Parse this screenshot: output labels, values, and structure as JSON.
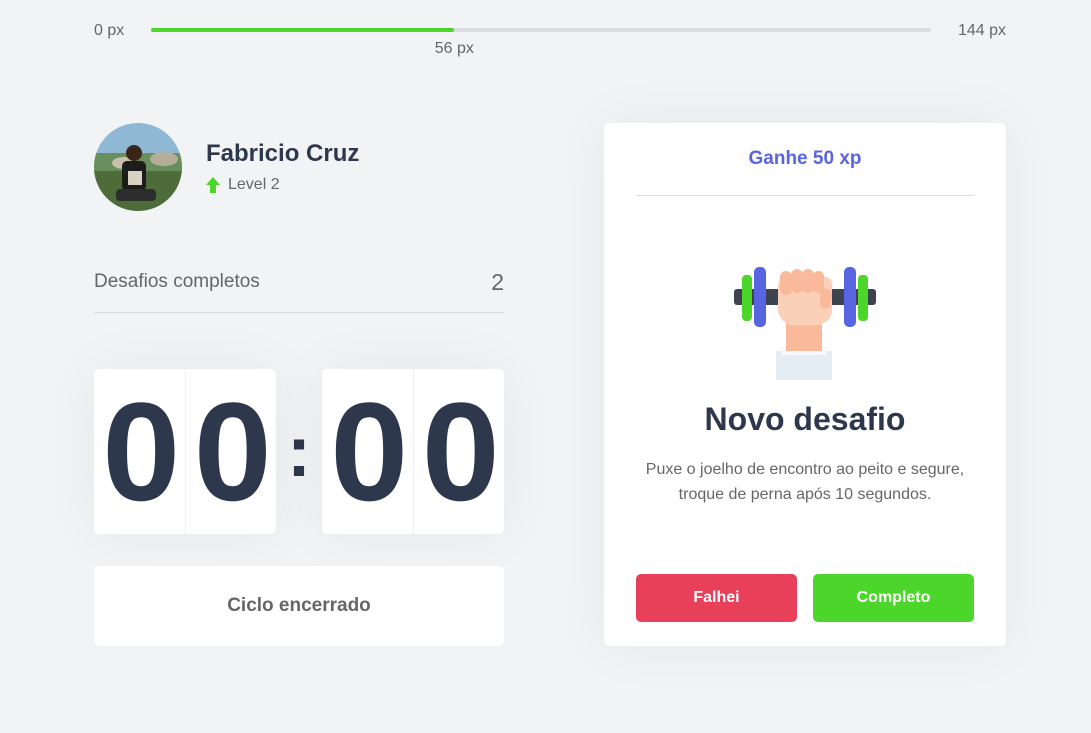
{
  "xp": {
    "min_label": "0 px",
    "max_label": "144 px",
    "current_label": "56 px",
    "current": 56,
    "max": 144,
    "fill_color": "#4cd62b"
  },
  "profile": {
    "name": "Fabricio Cruz",
    "level_label": "Level 2",
    "level_icon": "arrow-up-icon"
  },
  "completed": {
    "label": "Desafios completos",
    "count": "2"
  },
  "countdown": {
    "minute_left": "0",
    "minute_right": "0",
    "separator": ":",
    "second_left": "0",
    "second_right": "0"
  },
  "cycle": {
    "button_label": "Ciclo encerrado"
  },
  "challenge": {
    "header": "Ganhe 50 xp",
    "icon": "dumbbell-icon",
    "title": "Novo desafio",
    "description": "Puxe o joelho de encontro ao peito e segure, troque de perna após 10 segundos.",
    "fail_label": "Falhei",
    "success_label": "Completo"
  },
  "colors": {
    "accent": "#5965e0",
    "success": "#4cd62b",
    "danger": "#e83f5b",
    "text": "#2e384d",
    "background": "#f2f3f5"
  }
}
